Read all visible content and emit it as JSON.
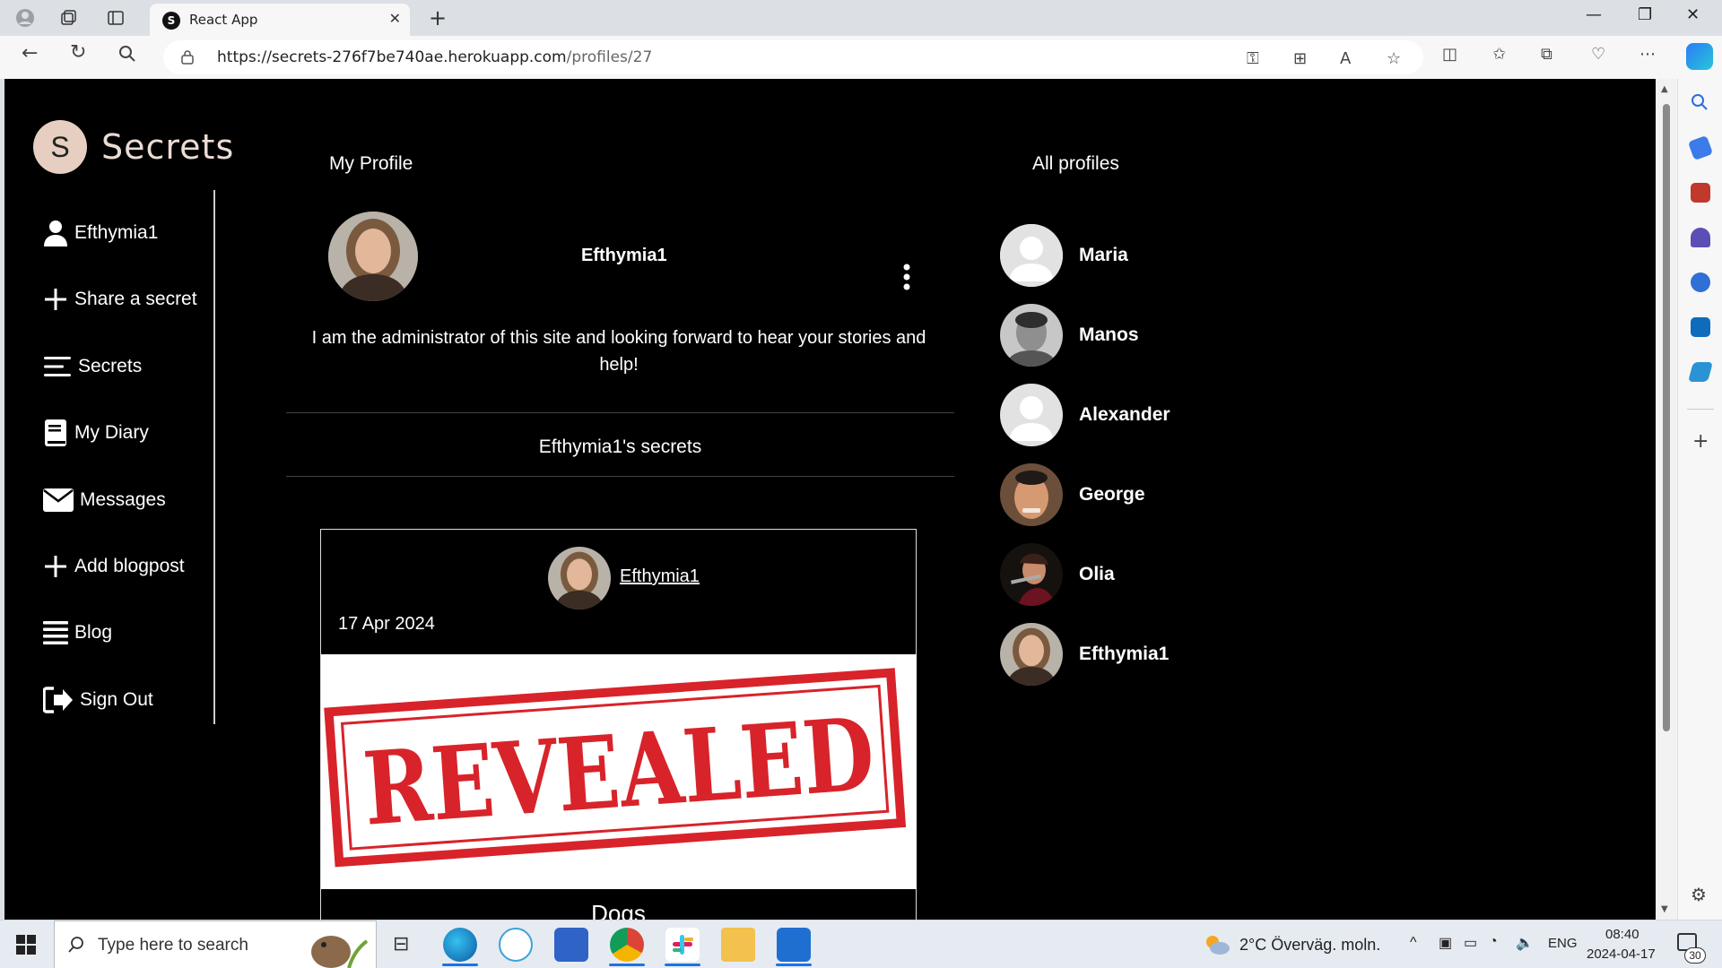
{
  "browser": {
    "tab_title": "React App",
    "url_host": "https://secrets-276f7be740ae.herokuapp.com",
    "url_path": "/profiles/27"
  },
  "app": {
    "logo_letter": "S",
    "logo_text": "Secrets",
    "nav": [
      {
        "label": "Efthymia1",
        "icon": "user-icon"
      },
      {
        "label": "Share a secret",
        "icon": "plus-icon"
      },
      {
        "label": "Secrets",
        "icon": "lines-icon"
      },
      {
        "label": "My Diary",
        "icon": "book-icon"
      },
      {
        "label": "Messages",
        "icon": "envelope-icon"
      },
      {
        "label": "Add blogpost",
        "icon": "plus-icon"
      },
      {
        "label": "Blog",
        "icon": "list-icon"
      },
      {
        "label": "Sign Out",
        "icon": "sign-out-icon"
      }
    ]
  },
  "profile": {
    "section_title": "My Profile",
    "name": "Efthymia1",
    "bio": "I am the administrator of this site and looking forward to hear your stories and help!",
    "secrets_heading": "Efthymia1's secrets"
  },
  "secret_card": {
    "author": "Efthymia1",
    "date": "17 Apr 2024",
    "image_text": "REVEALED",
    "title_partial": "Dogs"
  },
  "all_profiles": {
    "title": "All profiles",
    "items": [
      "Maria",
      "Manos",
      "Alexander",
      "George",
      "Olia",
      "Efthymia1"
    ]
  },
  "taskbar": {
    "search_placeholder": "Type here to search",
    "weather": "2°C  Överväg. moln.",
    "lang": "ENG",
    "time": "08:40",
    "date": "2024-04-17",
    "notif_count": "30"
  },
  "colors": {
    "page_bg": "#000000",
    "logo_circle": "#e6cfc0",
    "stamp_red": "#d8232a"
  }
}
